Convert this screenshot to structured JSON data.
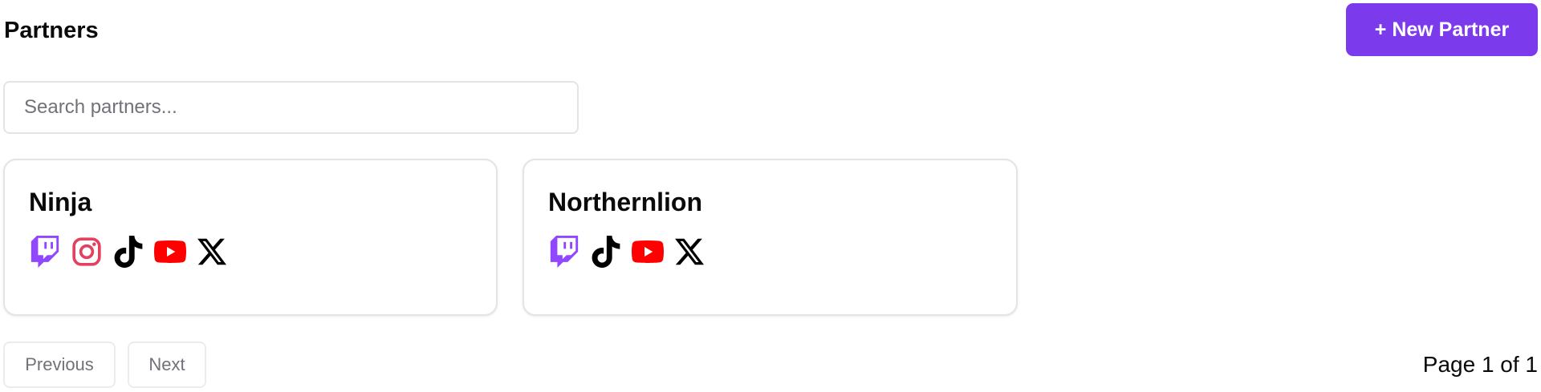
{
  "header": {
    "title": "Partners",
    "new_partner_label": "+ New Partner"
  },
  "search": {
    "placeholder": "Search partners...",
    "value": ""
  },
  "partners": [
    {
      "name": "Ninja",
      "platforms": [
        "twitch-icon",
        "instagram-icon",
        "tiktok-icon",
        "youtube-icon",
        "x-icon"
      ]
    },
    {
      "name": "Northernlion",
      "platforms": [
        "twitch-icon",
        "tiktok-icon",
        "youtube-icon",
        "x-icon"
      ]
    }
  ],
  "pagination": {
    "previous_label": "Previous",
    "next_label": "Next",
    "page_text": "Page 1 of 1"
  },
  "colors": {
    "accent": "#7c3aed",
    "twitch": "#9146ff",
    "instagram": "#e4405f",
    "youtube": "#ff0000",
    "tiktok": "#000000",
    "x": "#000000"
  }
}
